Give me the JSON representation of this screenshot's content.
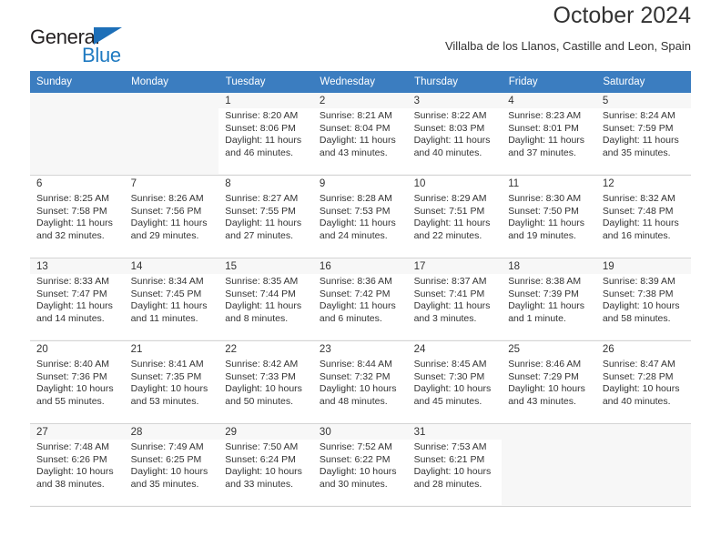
{
  "brand": {
    "name_part1": "General",
    "name_part2": "Blue",
    "accent_color": "#1f7ac1",
    "triangle_color": "#1d6fb8"
  },
  "header": {
    "title": "October 2024",
    "subtitle": "Villalba de los Llanos, Castille and Leon, Spain"
  },
  "calendar": {
    "header_bg": "#3b7dc0",
    "weekday_headers": [
      "Sunday",
      "Monday",
      "Tuesday",
      "Wednesday",
      "Thursday",
      "Friday",
      "Saturday"
    ],
    "weeks": [
      [
        {
          "day": "",
          "lines": []
        },
        {
          "day": "",
          "lines": []
        },
        {
          "day": "1",
          "lines": [
            "Sunrise: 8:20 AM",
            "Sunset: 8:06 PM",
            "Daylight: 11 hours",
            "and 46 minutes."
          ]
        },
        {
          "day": "2",
          "lines": [
            "Sunrise: 8:21 AM",
            "Sunset: 8:04 PM",
            "Daylight: 11 hours",
            "and 43 minutes."
          ]
        },
        {
          "day": "3",
          "lines": [
            "Sunrise: 8:22 AM",
            "Sunset: 8:03 PM",
            "Daylight: 11 hours",
            "and 40 minutes."
          ]
        },
        {
          "day": "4",
          "lines": [
            "Sunrise: 8:23 AM",
            "Sunset: 8:01 PM",
            "Daylight: 11 hours",
            "and 37 minutes."
          ]
        },
        {
          "day": "5",
          "lines": [
            "Sunrise: 8:24 AM",
            "Sunset: 7:59 PM",
            "Daylight: 11 hours",
            "and 35 minutes."
          ]
        }
      ],
      [
        {
          "day": "6",
          "lines": [
            "Sunrise: 8:25 AM",
            "Sunset: 7:58 PM",
            "Daylight: 11 hours",
            "and 32 minutes."
          ]
        },
        {
          "day": "7",
          "lines": [
            "Sunrise: 8:26 AM",
            "Sunset: 7:56 PM",
            "Daylight: 11 hours",
            "and 29 minutes."
          ]
        },
        {
          "day": "8",
          "lines": [
            "Sunrise: 8:27 AM",
            "Sunset: 7:55 PM",
            "Daylight: 11 hours",
            "and 27 minutes."
          ]
        },
        {
          "day": "9",
          "lines": [
            "Sunrise: 8:28 AM",
            "Sunset: 7:53 PM",
            "Daylight: 11 hours",
            "and 24 minutes."
          ]
        },
        {
          "day": "10",
          "lines": [
            "Sunrise: 8:29 AM",
            "Sunset: 7:51 PM",
            "Daylight: 11 hours",
            "and 22 minutes."
          ]
        },
        {
          "day": "11",
          "lines": [
            "Sunrise: 8:30 AM",
            "Sunset: 7:50 PM",
            "Daylight: 11 hours",
            "and 19 minutes."
          ]
        },
        {
          "day": "12",
          "lines": [
            "Sunrise: 8:32 AM",
            "Sunset: 7:48 PM",
            "Daylight: 11 hours",
            "and 16 minutes."
          ]
        }
      ],
      [
        {
          "day": "13",
          "lines": [
            "Sunrise: 8:33 AM",
            "Sunset: 7:47 PM",
            "Daylight: 11 hours",
            "and 14 minutes."
          ]
        },
        {
          "day": "14",
          "lines": [
            "Sunrise: 8:34 AM",
            "Sunset: 7:45 PM",
            "Daylight: 11 hours",
            "and 11 minutes."
          ]
        },
        {
          "day": "15",
          "lines": [
            "Sunrise: 8:35 AM",
            "Sunset: 7:44 PM",
            "Daylight: 11 hours",
            "and 8 minutes."
          ]
        },
        {
          "day": "16",
          "lines": [
            "Sunrise: 8:36 AM",
            "Sunset: 7:42 PM",
            "Daylight: 11 hours",
            "and 6 minutes."
          ]
        },
        {
          "day": "17",
          "lines": [
            "Sunrise: 8:37 AM",
            "Sunset: 7:41 PM",
            "Daylight: 11 hours",
            "and 3 minutes."
          ]
        },
        {
          "day": "18",
          "lines": [
            "Sunrise: 8:38 AM",
            "Sunset: 7:39 PM",
            "Daylight: 11 hours",
            "and 1 minute."
          ]
        },
        {
          "day": "19",
          "lines": [
            "Sunrise: 8:39 AM",
            "Sunset: 7:38 PM",
            "Daylight: 10 hours",
            "and 58 minutes."
          ]
        }
      ],
      [
        {
          "day": "20",
          "lines": [
            "Sunrise: 8:40 AM",
            "Sunset: 7:36 PM",
            "Daylight: 10 hours",
            "and 55 minutes."
          ]
        },
        {
          "day": "21",
          "lines": [
            "Sunrise: 8:41 AM",
            "Sunset: 7:35 PM",
            "Daylight: 10 hours",
            "and 53 minutes."
          ]
        },
        {
          "day": "22",
          "lines": [
            "Sunrise: 8:42 AM",
            "Sunset: 7:33 PM",
            "Daylight: 10 hours",
            "and 50 minutes."
          ]
        },
        {
          "day": "23",
          "lines": [
            "Sunrise: 8:44 AM",
            "Sunset: 7:32 PM",
            "Daylight: 10 hours",
            "and 48 minutes."
          ]
        },
        {
          "day": "24",
          "lines": [
            "Sunrise: 8:45 AM",
            "Sunset: 7:30 PM",
            "Daylight: 10 hours",
            "and 45 minutes."
          ]
        },
        {
          "day": "25",
          "lines": [
            "Sunrise: 8:46 AM",
            "Sunset: 7:29 PM",
            "Daylight: 10 hours",
            "and 43 minutes."
          ]
        },
        {
          "day": "26",
          "lines": [
            "Sunrise: 8:47 AM",
            "Sunset: 7:28 PM",
            "Daylight: 10 hours",
            "and 40 minutes."
          ]
        }
      ],
      [
        {
          "day": "27",
          "lines": [
            "Sunrise: 7:48 AM",
            "Sunset: 6:26 PM",
            "Daylight: 10 hours",
            "and 38 minutes."
          ]
        },
        {
          "day": "28",
          "lines": [
            "Sunrise: 7:49 AM",
            "Sunset: 6:25 PM",
            "Daylight: 10 hours",
            "and 35 minutes."
          ]
        },
        {
          "day": "29",
          "lines": [
            "Sunrise: 7:50 AM",
            "Sunset: 6:24 PM",
            "Daylight: 10 hours",
            "and 33 minutes."
          ]
        },
        {
          "day": "30",
          "lines": [
            "Sunrise: 7:52 AM",
            "Sunset: 6:22 PM",
            "Daylight: 10 hours",
            "and 30 minutes."
          ]
        },
        {
          "day": "31",
          "lines": [
            "Sunrise: 7:53 AM",
            "Sunset: 6:21 PM",
            "Daylight: 10 hours",
            "and 28 minutes."
          ]
        },
        {
          "day": "",
          "lines": []
        },
        {
          "day": "",
          "lines": []
        }
      ]
    ]
  }
}
